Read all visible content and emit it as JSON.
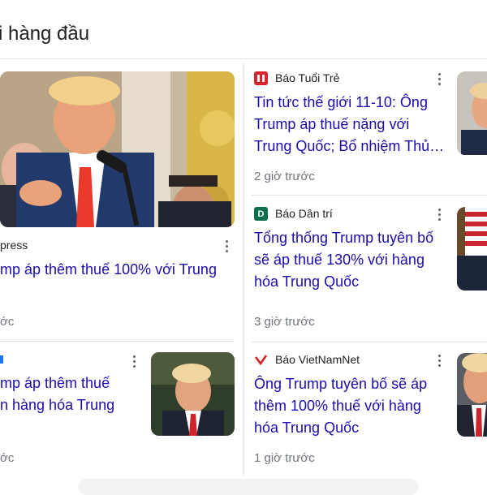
{
  "section": {
    "title": "i hàng đầu"
  },
  "colors": {
    "link": "#1a0dab",
    "tuoitre": "#d9232e",
    "dantri": "#0b6e4f",
    "vietnamnet": "#d5222a"
  },
  "left": {
    "featured": {
      "source": "press",
      "headline": "mp áp thêm thuế 100% với Trung",
      "time": "ớc"
    },
    "second": {
      "headline_line1": "mp áp thêm thuế",
      "headline_line2": "n hàng hóa Trung",
      "time": "ớc"
    }
  },
  "right": {
    "cards": [
      {
        "source": "Báo Tuổi Trẻ",
        "logo_icon": "tuoitre-logo-icon",
        "headline": "Tin tức thế giới 11-10: Ông Trump áp thuế nặng với Trung Quốc; Bổ nhiệm Thủ…",
        "time": "2 giờ trước"
      },
      {
        "source": "Báo Dân trí",
        "logo_icon": "dantri-logo-icon",
        "headline": "Tổng thống Trump tuyên bố sẽ áp thuế 130% với hàng hóa Trung Quốc",
        "time": "3 giờ trước"
      },
      {
        "source": "Báo VietNamNet",
        "logo_icon": "vietnamnet-logo-icon",
        "headline": "Ông Trump tuyên bố sẽ áp thêm 100% thuế với hàng hóa Trung Quốc",
        "time": "1 giờ trước"
      }
    ]
  }
}
